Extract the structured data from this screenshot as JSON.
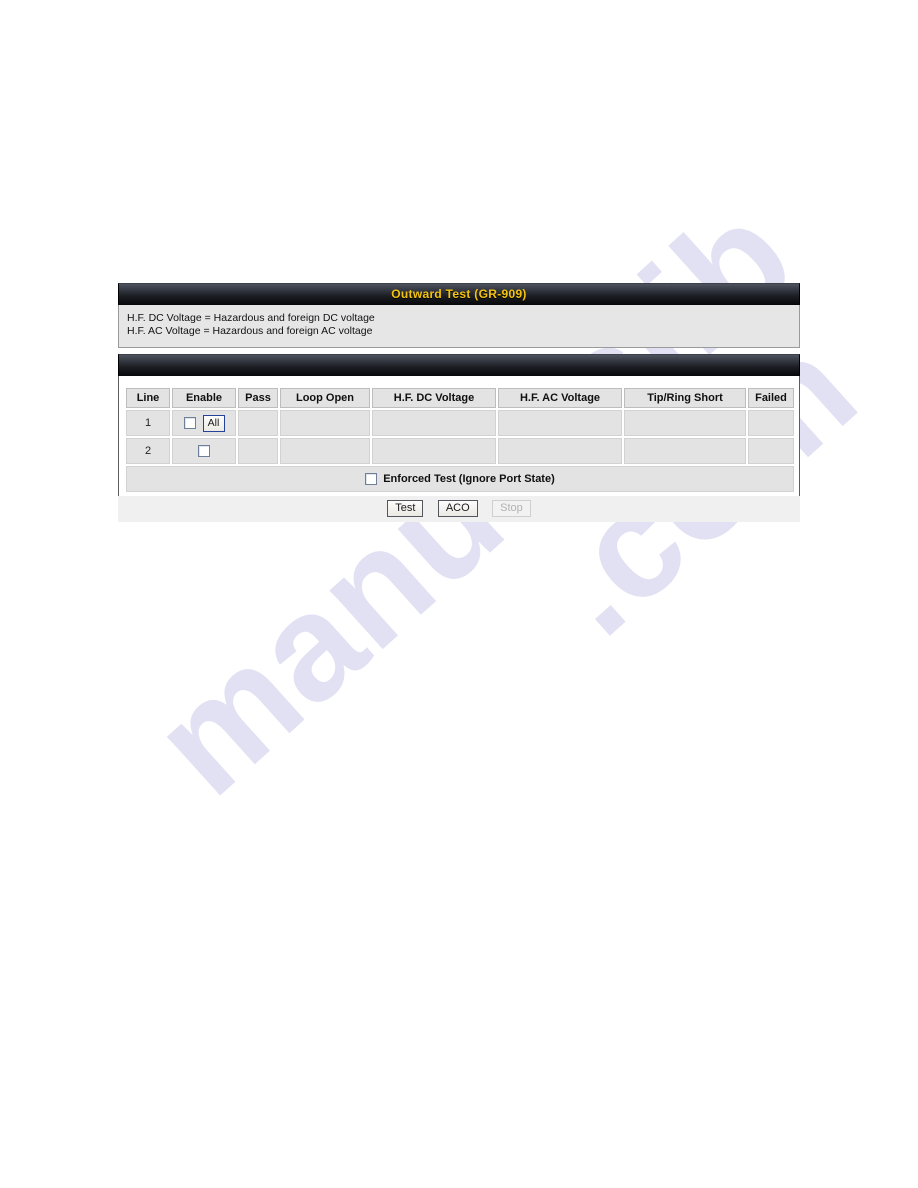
{
  "panel": {
    "title": "Outward Test (GR-909)",
    "description_lines": [
      "H.F. DC Voltage = Hazardous and foreign DC voltage",
      "H.F. AC Voltage = Hazardous and foreign AC voltage"
    ]
  },
  "table": {
    "columns": [
      "Line",
      "Enable",
      "Pass",
      "Loop Open",
      "H.F. DC Voltage",
      "H.F. AC Voltage",
      "Tip/Ring Short",
      "Failed"
    ],
    "rows": [
      {
        "line": "1",
        "enable_checked": false,
        "all_button": "All",
        "pass": "",
        "loop_open": "",
        "hf_dc_voltage": "",
        "hf_ac_voltage": "",
        "tip_ring_short": "",
        "failed": ""
      },
      {
        "line": "2",
        "enable_checked": false,
        "pass": "",
        "loop_open": "",
        "hf_dc_voltage": "",
        "hf_ac_voltage": "",
        "tip_ring_short": "",
        "failed": ""
      }
    ],
    "enforced_test": {
      "label": "Enforced Test (Ignore Port State)",
      "checked": false
    }
  },
  "buttons": [
    {
      "label": "Test",
      "disabled": false
    },
    {
      "label": "ACO",
      "disabled": false
    },
    {
      "label": "Stop",
      "disabled": true
    }
  ],
  "watermark": {
    "line_a": "manualslib",
    "line_b": ".com"
  },
  "colors": {
    "title_text": "#f3c30d",
    "title_bar_top": "#4e525e",
    "title_bar_bottom": "#06070a",
    "panel_background": "#e6e6e6",
    "cell_background": "#e3e3e3",
    "button_border": "#53565c",
    "all_button_border": "#27409a",
    "watermark": "#c9c9ea"
  }
}
